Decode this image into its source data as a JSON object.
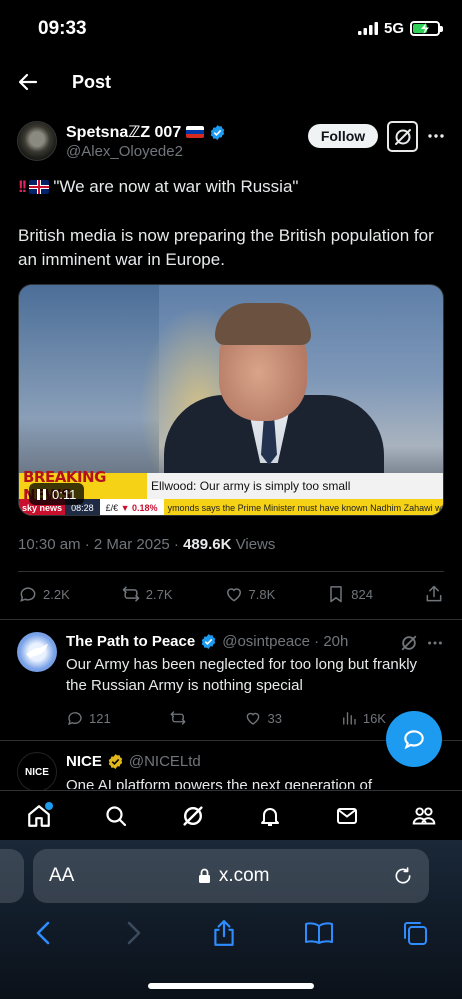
{
  "status_bar": {
    "time": "09:33",
    "network": "5G",
    "battery_level": 0.55
  },
  "header": {
    "title": "Post"
  },
  "author": {
    "name": "SpetsnaℤZ 007",
    "handle": "@Alex_Oloyede2",
    "follow_label": "Follow"
  },
  "tweet": {
    "line1": "\"We are now at war with Russia\"",
    "body": "British media is now preparing the British population for an imminent war in Europe."
  },
  "video": {
    "breaking": "BREAKING NEWS",
    "lower_third": "Ellwood: Our army is simply too small",
    "ticker_brand": "sky",
    "ticker_brand2": "news",
    "ticker_time": "08:28",
    "ticker_fx": "£/€",
    "ticker_fx_change": "▼ 0.18%",
    "ticker_news": "ymonds says the Prime Minister must have known Nadhim Zahawi was",
    "timer": "0:11"
  },
  "meta": {
    "time_date": "10:30 am · 2 Mar 2025 · ",
    "views_count": "489.6K",
    "views_label": " Views"
  },
  "actions": {
    "replies": "2.2K",
    "reposts": "2.7K",
    "likes": "7.8K",
    "bookmarks": "824"
  },
  "reply1": {
    "name": "The Path to Peace",
    "handle_time": "@osintpeace · 20h",
    "text": "Our Army has been neglected for too long but frankly the Russian Army is nothing special",
    "replies": "121",
    "likes": "33",
    "views": "16K"
  },
  "reply2": {
    "avatar_text": "NICE",
    "name": "NICE",
    "handle": "@NICELtd",
    "text": "One AI platform powers the next generation of"
  },
  "safari": {
    "aa": "AA",
    "domain": "x.com"
  },
  "colors": {
    "accent": "#1d9bf0",
    "background": "#000000",
    "muted": "#71767b"
  }
}
